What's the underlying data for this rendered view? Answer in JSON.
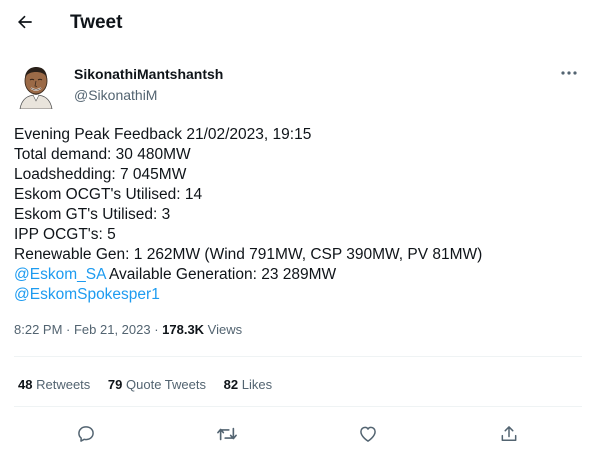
{
  "header": {
    "title": "Tweet"
  },
  "author": {
    "name": "SikonathiMantshantsh",
    "handle": "@SikonathiM"
  },
  "tweet": {
    "lines": [
      "Evening Peak Feedback 21/02/2023, 19:15",
      "Total demand: 30 480MW",
      "Loadshedding: 7 045MW",
      "Eskom OCGT's Utilised: 14",
      "Eskom GT's Utilised: 3",
      "IPP OCGT's: 5",
      "Renewable Gen: 1 262MW (Wind 791MW, CSP 390MW, PV 81MW)"
    ],
    "mention_1": "@Eskom_SA",
    "line_8_rest": " Available Generation: 23 289MW",
    "mention_2": "@EskomSpokesper1"
  },
  "meta": {
    "timestamp": "8:22 PM · Feb 21, 2023 · ",
    "views_count": "178.3K",
    "views_label": " Views"
  },
  "stats": {
    "retweets_count": "48",
    "retweets_label": "Retweets",
    "quotes_count": "79",
    "quotes_label": "Quote Tweets",
    "likes_count": "82",
    "likes_label": "Likes"
  },
  "icons": {
    "back": "arrow-left-icon",
    "more": "more-horizontal-icon",
    "reply": "reply-icon",
    "retweet": "retweet-icon",
    "like": "heart-icon",
    "share": "share-icon"
  },
  "colors": {
    "accent": "#1d9bf0",
    "text": "#0f1419",
    "secondary": "#536471",
    "divider": "#eff3f4"
  }
}
